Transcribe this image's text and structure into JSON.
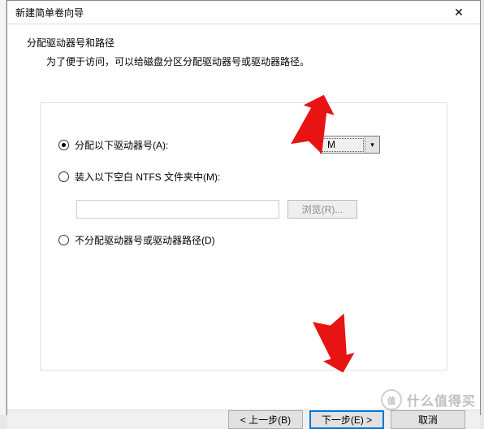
{
  "window": {
    "title": "新建简单卷向导",
    "close_glyph": "✕"
  },
  "header": {
    "title": "分配驱动器号和路径",
    "desc": "为了便于访问，可以给磁盘分区分配驱动器号或驱动器路径。"
  },
  "options": {
    "assign": {
      "label": "分配以下驱动器号(A):",
      "checked": true
    },
    "mount": {
      "label": "装入以下空白 NTFS 文件夹中(M):",
      "checked": false
    },
    "none": {
      "label": "不分配驱动器号或驱动器路径(D)",
      "checked": false
    }
  },
  "drive": {
    "selected": "M",
    "arrow": "▾"
  },
  "path": {
    "value": "",
    "browse_label": "浏览(R)..."
  },
  "footer": {
    "back": "< 上一步(B)",
    "next": "下一步(E) >",
    "cancel": "取消"
  },
  "watermark": {
    "logo": "值",
    "text": "什么值得买"
  }
}
